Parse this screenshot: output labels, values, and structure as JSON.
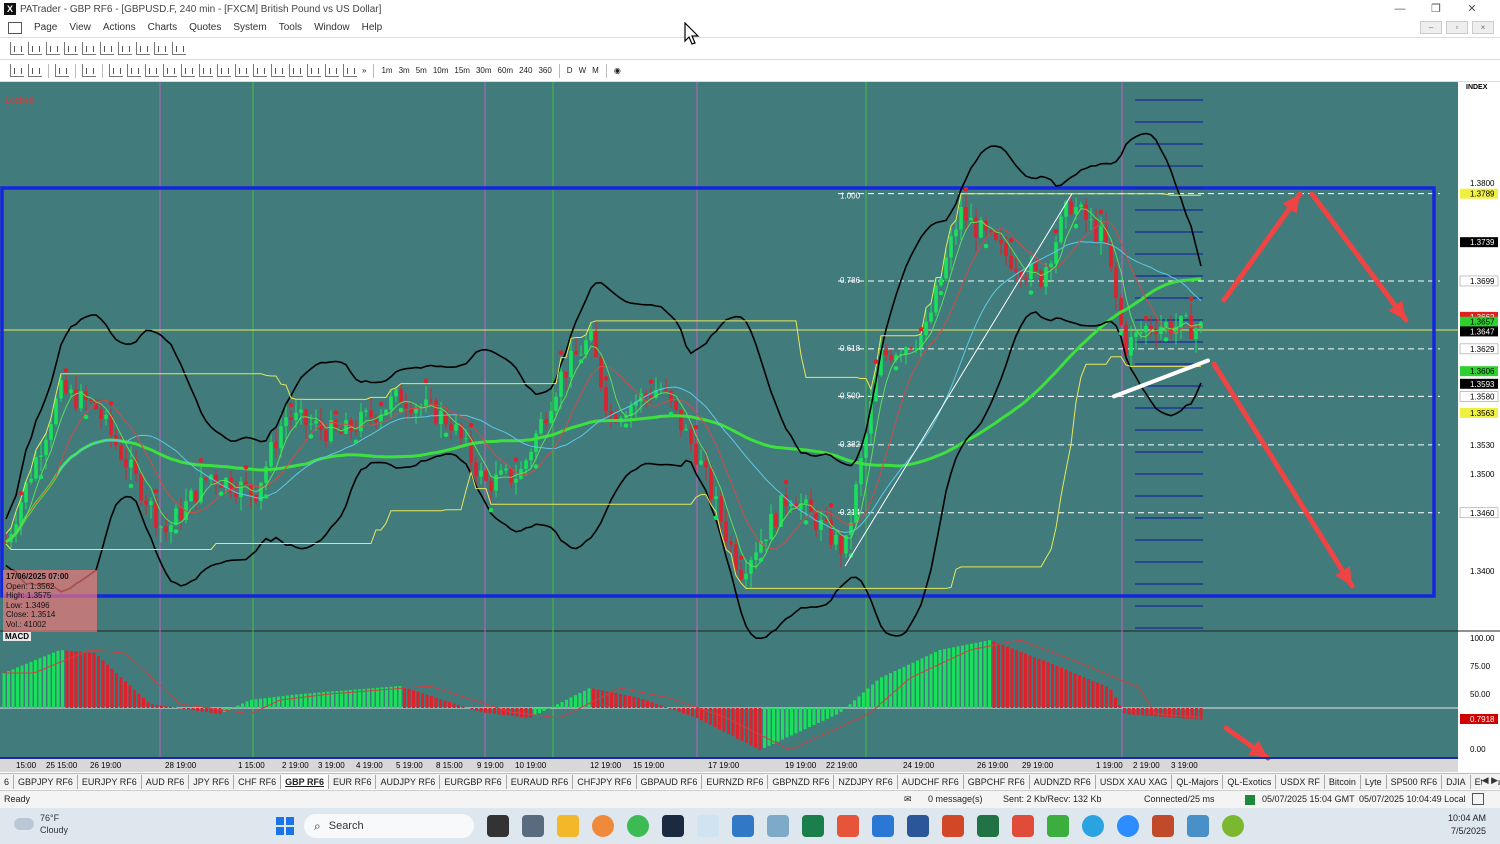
{
  "window": {
    "title": "PATrader - GBP RF6 - [GBPUSD.F, 240 min - [FXCM] British Pound vs US Dollar]",
    "app_icon": "X",
    "min_label": "—",
    "max_label": "❐",
    "close_label": "✕"
  },
  "menu": {
    "items": [
      "Page",
      "View",
      "Actions",
      "Charts",
      "Quotes",
      "System",
      "Tools",
      "Window",
      "Help"
    ]
  },
  "timeframes": [
    "1m",
    "3m",
    "5m",
    "10m",
    "15m",
    "30m",
    "60m",
    "240",
    "360",
    "D",
    "W",
    "M"
  ],
  "chart": {
    "locked_label": "Locked",
    "index_label": "INDEX",
    "macd_label": "MACD",
    "info": {
      "date": "17/06/2025 07:00",
      "open": "Open: 1.3562",
      "high": "High: 1.3575",
      "low": "Low: 1.3496",
      "close": "Close: 1.3514",
      "vol": "Vol.: 41002"
    },
    "price_labels": [
      {
        "text": "1.3800",
        "v": 1.38,
        "style": "plain"
      },
      {
        "text": "1.3789",
        "v": 1.3789,
        "style": "yellow"
      },
      {
        "text": "1.3739",
        "v": 1.3739,
        "style": "black"
      },
      {
        "text": "1.3699",
        "v": 1.3699,
        "style": "white"
      },
      {
        "text": "1.3662",
        "v": 1.3662,
        "style": "red"
      },
      {
        "text": "1.3657",
        "v": 1.3657,
        "style": "green"
      },
      {
        "text": "1.3647",
        "v": 1.3647,
        "style": "black"
      },
      {
        "text": "1.3629",
        "v": 1.3629,
        "style": "white"
      },
      {
        "text": "1.3606",
        "v": 1.3606,
        "style": "green"
      },
      {
        "text": "1.3593",
        "v": 1.3593,
        "style": "black"
      },
      {
        "text": "1.3580",
        "v": 1.358,
        "style": "white"
      },
      {
        "text": "1.3563",
        "v": 1.3563,
        "style": "yellow"
      },
      {
        "text": "1.3530",
        "v": 1.353,
        "style": "plain"
      },
      {
        "text": "1.3500",
        "v": 1.35,
        "style": "plain"
      },
      {
        "text": "1.3460",
        "v": 1.346,
        "style": "white"
      },
      {
        "text": "1.3400",
        "v": 1.34,
        "style": "plain"
      }
    ],
    "fib_levels": [
      {
        "label": "1.000",
        "v": 1.3789
      },
      {
        "label": "0.786",
        "v": 1.3699
      },
      {
        "label": "0.618",
        "v": 1.3629
      },
      {
        "label": "0.500",
        "v": 1.358
      },
      {
        "label": "0.382",
        "v": 1.353
      },
      {
        "label": "0.214",
        "v": 1.346
      }
    ],
    "macd_labels": [
      "100.00",
      "75.00",
      "50.00",
      "0.00"
    ],
    "macd_value": "0.7918",
    "date_labels": [
      "15:00",
      "25 15:00",
      "26 19:00",
      "28 19:00",
      "1 15:00",
      "2 19:00",
      "3 19:00",
      "4 19:00",
      "5 19:00",
      "8 15:00",
      "9 19:00",
      "10 19:00",
      "12 19:00",
      "15 19:00",
      "17 19:00",
      "19 19:00",
      "22 19:00",
      "24 19:00",
      "26 19:00",
      "29 19:00",
      "1 19:00",
      "2 19:00",
      "3 19:00"
    ],
    "colors": {
      "background": "#417b7b",
      "bull": "#19e05a",
      "bear": "#e0202a",
      "box": "#1626e0",
      "ma_green": "#3ee03e",
      "bb": "#000000",
      "arrow": "#ef4444"
    }
  },
  "tabs": {
    "items": [
      "6",
      "GBPJPY RF6",
      "EURJPY RF6",
      "AUD RF6",
      "JPY RF6",
      "CHF RF6",
      "GBP RF6",
      "EUR RF6",
      "AUDJPY RF6",
      "EURGBP RF6",
      "EURAUD RF6",
      "CHFJPY RF6",
      "GBPAUD RF6",
      "EURNZD RF6",
      "GBPNZD RF6",
      "NZDJPY RF6",
      "AUDCHF RF6",
      "GBPCHF RF6",
      "AUDNZD RF6",
      "USDX XAU XAG",
      "QL-Majors",
      "QL-Exotics",
      "USDX RF",
      "Bitcoin",
      "Lyte",
      "SP500 RF6",
      "DJIA",
      "Ethirium"
    ],
    "active": "GBP RF6",
    "arrows": "◀ ▶"
  },
  "status": {
    "ready": "Ready",
    "messages": "0 message(s)",
    "sent": "Sent: 2 Kb/Recv: 132 Kb",
    "connected": "Connected/25 ms",
    "gmt": "05/07/2025 15:04 GMT",
    "local": "05/07/2025 10:04:49 Local"
  },
  "taskbar": {
    "temp": "76°F",
    "weather": "Cloudy",
    "search": "Search",
    "time": "10:04 AM",
    "date": "7/5/2025"
  }
}
